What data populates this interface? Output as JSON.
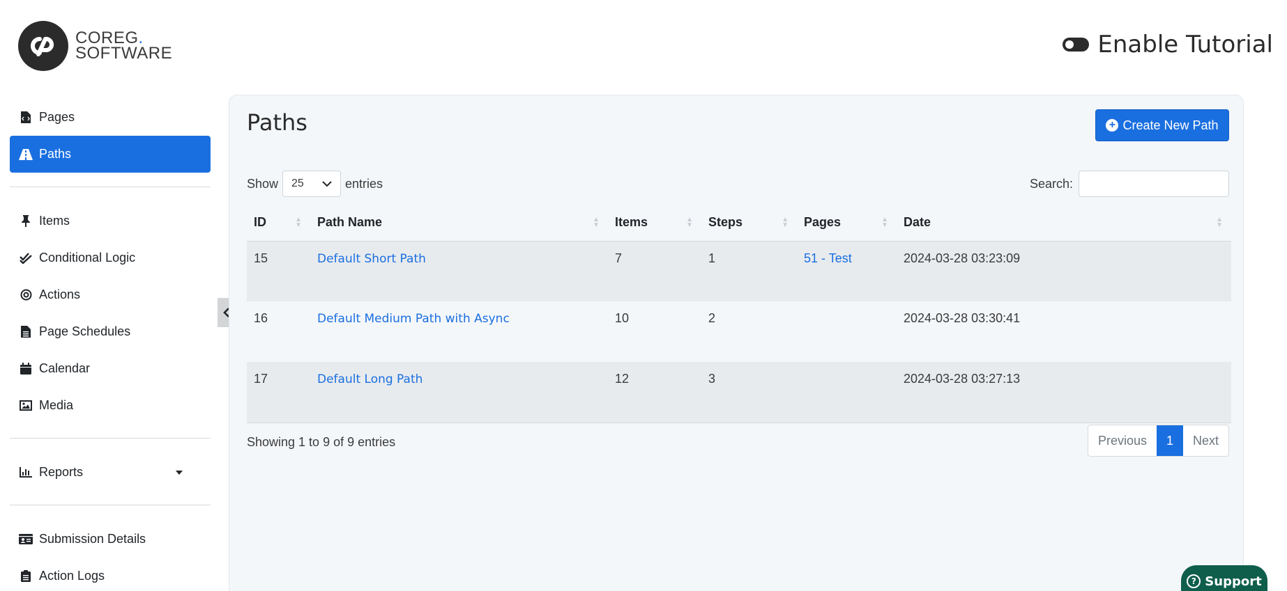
{
  "brand": {
    "line1": "COREG",
    "dot": ".",
    "line2": "SOFTWARE"
  },
  "header": {
    "tutorial_label": "Enable Tutorial"
  },
  "sidebar": {
    "items": [
      {
        "label": "Pages",
        "icon": "file-code-icon"
      },
      {
        "label": "Paths",
        "icon": "road-icon",
        "active": true
      },
      {
        "label": "Items",
        "icon": "thumbtack-icon"
      },
      {
        "label": "Conditional Logic",
        "icon": "check-double-icon"
      },
      {
        "label": "Actions",
        "icon": "bullseye-icon"
      },
      {
        "label": "Page Schedules",
        "icon": "file-lines-icon"
      },
      {
        "label": "Calendar",
        "icon": "calendar-icon"
      },
      {
        "label": "Media",
        "icon": "image-icon"
      },
      {
        "label": "Reports",
        "icon": "chart-icon"
      },
      {
        "label": "Submission Details",
        "icon": "id-card-icon"
      },
      {
        "label": "Action Logs",
        "icon": "clipboard-list-icon"
      }
    ]
  },
  "main": {
    "title": "Paths",
    "create_label": "Create New Path",
    "show_label": "Show",
    "entries_value": "25",
    "entries_label": "entries",
    "search_label": "Search:",
    "columns": [
      "ID",
      "Path Name",
      "Items",
      "Steps",
      "Pages",
      "Date"
    ],
    "rows": [
      {
        "id": "15",
        "name": "Default Short Path",
        "items": "7",
        "steps": "1",
        "pages": "51 - Test",
        "date": "2024-03-28 03:23:09"
      },
      {
        "id": "16",
        "name": "Default Medium Path with Async",
        "items": "10",
        "steps": "2",
        "pages": "",
        "date": "2024-03-28 03:30:41"
      },
      {
        "id": "17",
        "name": "Default Long Path",
        "items": "12",
        "steps": "3",
        "pages": "",
        "date": "2024-03-28 03:27:13"
      }
    ],
    "info": "Showing 1 to 9 of 9 entries",
    "pager": {
      "prev": "Previous",
      "current": "1",
      "next": "Next"
    }
  },
  "support_label": "Support",
  "colors": {
    "accent": "#1a6fe0",
    "support": "#0f5e4c"
  }
}
